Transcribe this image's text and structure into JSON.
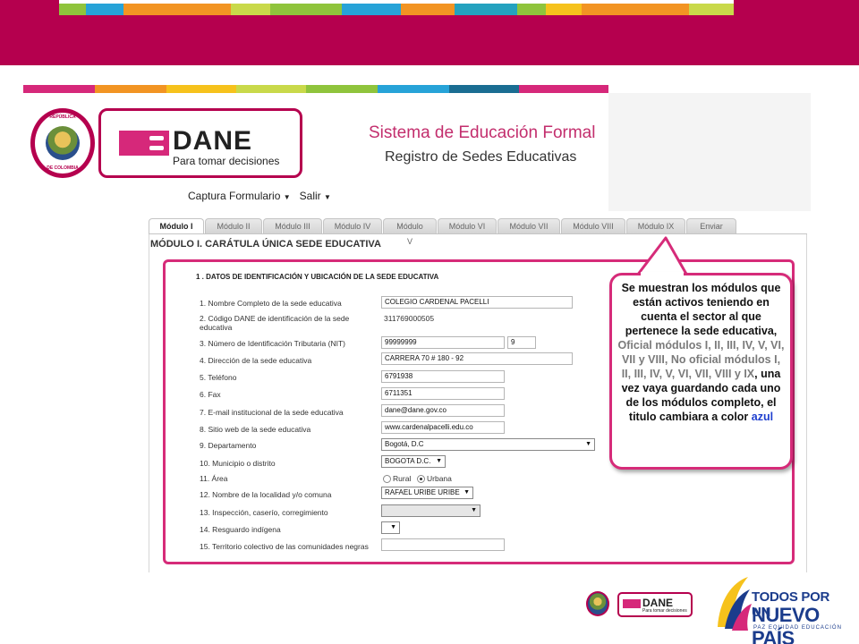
{
  "colors": {
    "brand_magenta": "#b5004e",
    "accent_pink": "#d62b79",
    "stripe": [
      "#8fc43c",
      "#27a3d8",
      "#f29423",
      "#c9d94a",
      "#24a2bf",
      "#f6c21c",
      "#d6287a",
      "#1a6d92"
    ]
  },
  "header": {
    "seal_top": "REPÚBLICA",
    "seal_bottom": "DE COLOMBIA",
    "logo_word": "DANE",
    "logo_tagline": "Para tomar decisiones",
    "system_title": "Sistema de Educación Formal",
    "system_subtitle": "Registro de Sedes Educativas"
  },
  "menu": {
    "items": [
      {
        "label": "Captura Formulario"
      },
      {
        "label": "Salir"
      }
    ]
  },
  "tabs": [
    {
      "label": "Módulo I"
    },
    {
      "label": "Módulo II"
    },
    {
      "label": "Módulo III"
    },
    {
      "label": "Módulo IV"
    },
    {
      "label": "Módulo V"
    },
    {
      "label": "Módulo VI"
    },
    {
      "label": "Módulo VII"
    },
    {
      "label": "Módulo VIII"
    },
    {
      "label": "Módulo IX"
    },
    {
      "label": "Enviar"
    }
  ],
  "module_title": "MÓDULO I. CARÁTULA ÚNICA SEDE EDUCATIVA",
  "section_title": "1 . DATOS DE IDENTIFICACIÓN Y UBICACIÓN DE LA SEDE EDUCATIVA",
  "fields": {
    "f1": {
      "label": "1. Nombre Completo de la sede educativa",
      "value": "COLEGIO CARDENAL PACELLI"
    },
    "f2": {
      "label": "2. Código DANE de identificación de la sede",
      "label2": "educativa",
      "value": "311769000505"
    },
    "f3": {
      "label": "3. Número de Identificación Tributaria (NIT)",
      "value": "99999999",
      "value2": "9"
    },
    "f4": {
      "label": "4. Dirección de la sede educativa",
      "value": "CARRERA 70 # 180 - 92"
    },
    "f5": {
      "label": "5. Teléfono",
      "value": "6791938"
    },
    "f6": {
      "label": "6. Fax",
      "value": "6711351"
    },
    "f7": {
      "label": "7. E-mail institucional de la sede educativa",
      "value": "dane@dane.gov.co"
    },
    "f8": {
      "label": "8. Sitio web de la sede educativa",
      "value": "www.cardenalpacelli.edu.co"
    },
    "f9": {
      "label": "9. Departamento",
      "value": "Bogotá, D.C"
    },
    "f10": {
      "label": "10. Municipio o distrito",
      "value": "BOGOTA D.C."
    },
    "f11": {
      "label": "11. Área",
      "option1": "Rural",
      "option2": "Urbana"
    },
    "f12": {
      "label": "12. Nombre de la localidad y/o comuna",
      "value": "RAFAEL URIBE URIBE"
    },
    "f13": {
      "label": "13. Inspección, caserío, corregimiento",
      "value": ""
    },
    "f14": {
      "label": "14. Resguardo indígena",
      "value": ""
    },
    "f15": {
      "label": "15. Territorio colectivo de las comunidades negras",
      "value": ""
    }
  },
  "callout": {
    "line_a": "Se muestran los módulos que están activos teniendo en cuenta el sector al que pertenece la sede educativa, ",
    "line_b": "Oficial módulos I, II, III, IV, V, VI, VII y VIII, No oficial módulos I, II, III, IV, V, VI, VII, VIII y IX",
    "line_c": ",  una vez vaya guardando cada uno de los módulos completo, el titulo cambiara a color ",
    "line_d": "azul"
  },
  "footer": {
    "dane_word": "DANE",
    "dane_tagline": "Para tomar decisiones",
    "slogan_1": "TODOS POR UN",
    "slogan_2": "NUEVO PAÍS",
    "slogan_3": "PAZ  EQUIDAD  EDUCACIÓN"
  }
}
